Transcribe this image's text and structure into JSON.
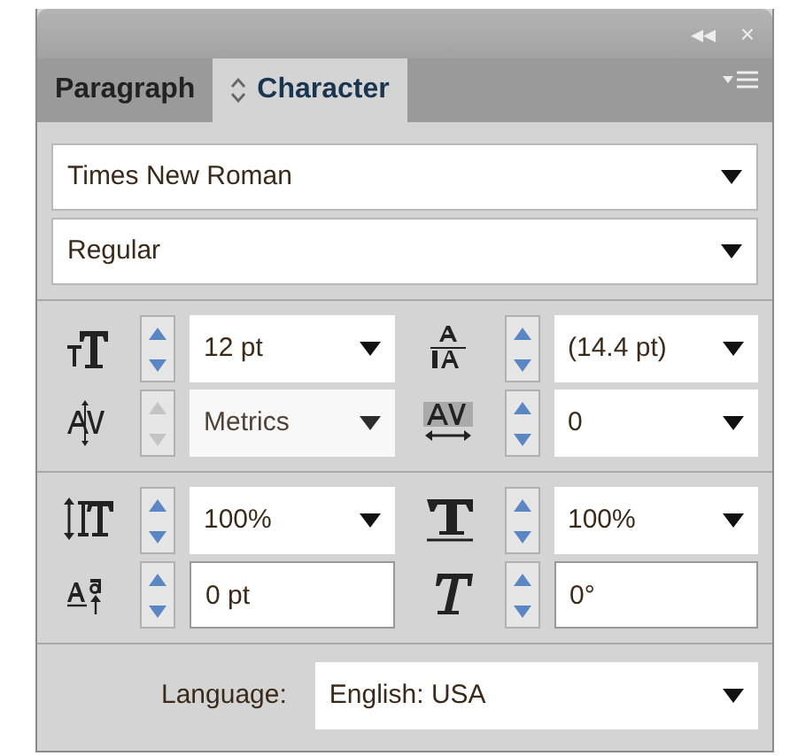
{
  "panel_buttons": [
    "◂◂",
    "×"
  ],
  "tabs": [
    {
      "label": "Paragraph",
      "selected": false
    },
    {
      "label": "Character",
      "selected": true
    }
  ],
  "font_family": {
    "value": "Times New Roman"
  },
  "font_style": {
    "value": "Regular"
  },
  "settings": [
    {
      "value": "12 pt",
      "kind": "dropdown",
      "disabled": false
    },
    {
      "value": "(14.4 pt)",
      "kind": "dropdown",
      "disabled": false
    },
    {
      "value": "Metrics",
      "kind": "dropdown",
      "disabled": true
    },
    {
      "value": "0",
      "kind": "dropdown",
      "disabled": false
    },
    {
      "value": "100%",
      "kind": "dropdown",
      "disabled": false
    },
    {
      "value": "100%",
      "kind": "dropdown",
      "disabled": false
    },
    {
      "value": "0 pt",
      "kind": "input",
      "disabled": false
    },
    {
      "value": "0°",
      "kind": "input",
      "disabled": false
    }
  ],
  "language": {
    "label": "Language:",
    "value": "English: USA"
  }
}
